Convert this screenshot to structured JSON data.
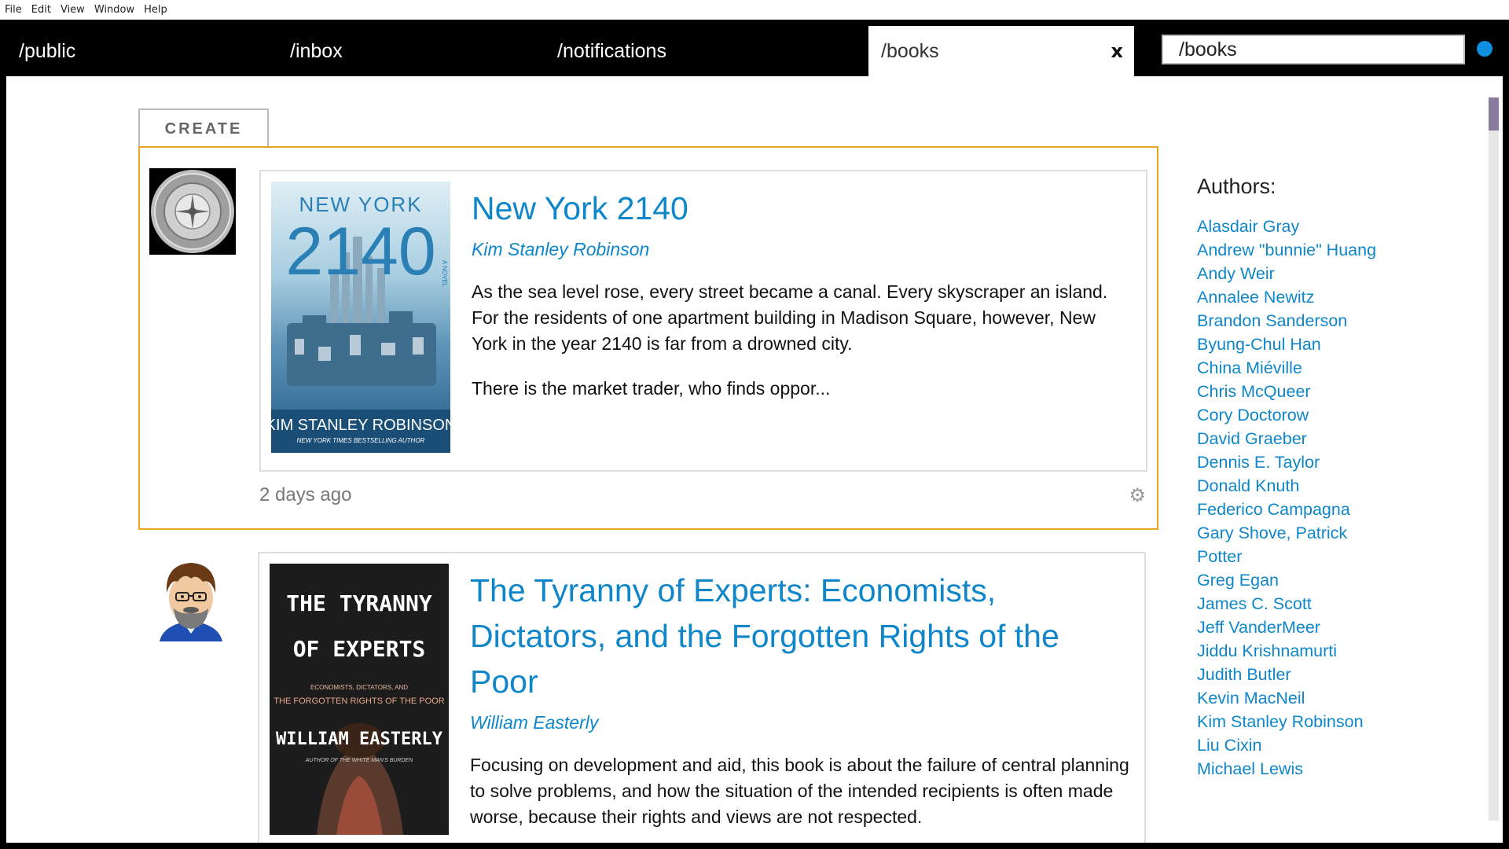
{
  "menu": [
    "File",
    "Edit",
    "View",
    "Window",
    "Help"
  ],
  "tabs": [
    {
      "label": "/public"
    },
    {
      "label": "/inbox"
    },
    {
      "label": "/notifications"
    },
    {
      "label": "/books",
      "close": "x"
    }
  ],
  "address": {
    "value": "/books"
  },
  "colors": {
    "accent": "#0e86c9",
    "selected_border": "#e8a424",
    "status_dot": "#0e8fe0"
  },
  "create_label": "CREATE",
  "posts": [
    {
      "title": "New York 2140",
      "author": "Kim Stanley Robinson",
      "desc": [
        "As the sea level rose, every street became a canal. Every skyscraper an island. For the residents of one apartment building in Madison Square, however, New York in the year 2140 is far from a drowned city.",
        "There is the market trader, who finds oppor..."
      ],
      "time": "2 days ago",
      "cover": {
        "top": "NEW YORK",
        "big": "2140",
        "side": "A NOVEL",
        "author": "KIM STANLEY ROBINSON",
        "tag": "NEW YORK TIMES BESTSELLING AUTHOR"
      }
    },
    {
      "title": "The Tyranny of Experts: Economists, Dictators, and the Forgotten Rights of the Poor",
      "author": "William Easterly",
      "desc": [
        "Focusing on development and aid, this book is about the failure of central planning to solve problems, and how the situation of the intended recipients is often made worse, because their rights and views are not respected."
      ],
      "cover": {
        "line1": "THE TYRANNY",
        "line2": "OF EXPERTS",
        "sub1": "ECONOMISTS, DICTATORS, AND",
        "sub2": "THE FORGOTTEN RIGHTS OF THE POOR",
        "author": "WILLIAM EASTERLY",
        "tag": "AUTHOR OF THE WHITE MAN'S BURDEN"
      }
    }
  ],
  "authors": {
    "title": "Authors:",
    "items": [
      "Alasdair Gray",
      "Andrew \"bunnie\" Huang",
      "Andy Weir",
      "Annalee Newitz",
      "Brandon Sanderson",
      "Byung-Chul Han",
      "China Miéville",
      "Chris McQueer",
      "Cory Doctorow",
      "David Graeber",
      "Dennis E. Taylor",
      "Donald Knuth",
      "Federico Campagna",
      "Gary Shove, Patrick Potter",
      "Greg Egan",
      "James C. Scott",
      "Jeff VanderMeer",
      "Jiddu Krishnamurti",
      "Judith Butler",
      "Kevin MacNeil",
      "Kim Stanley Robinson",
      "Liu Cixin",
      "Michael Lewis"
    ]
  }
}
